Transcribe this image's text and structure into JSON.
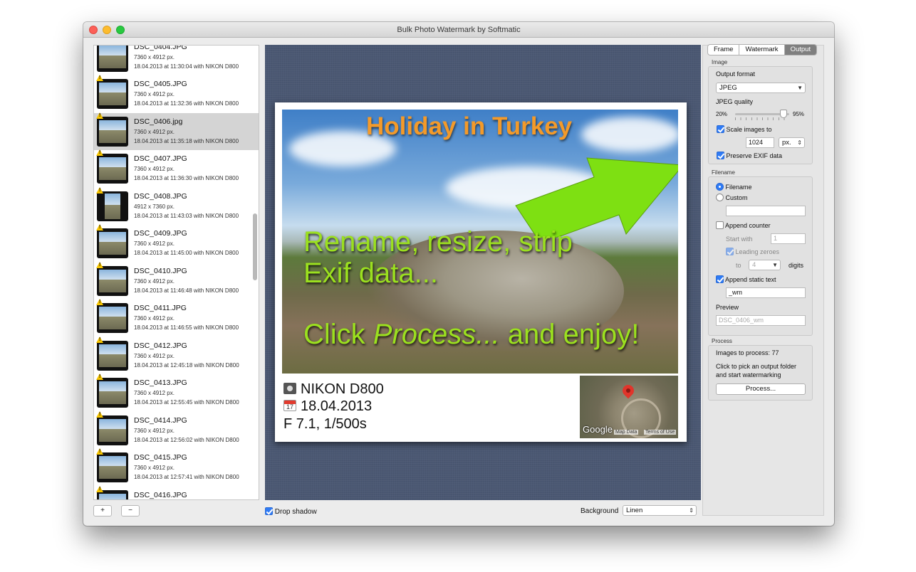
{
  "window": {
    "title": "Bulk Photo Watermark by Softmatic"
  },
  "files": [
    {
      "name": "DSC_0404.JPG",
      "dims": "7360 x 4912 px.",
      "date": "18.04.2013 at 11:30:04 with NIKON D800",
      "warn": false
    },
    {
      "name": "DSC_0405.JPG",
      "dims": "7360 x 4912 px.",
      "date": "18.04.2013 at 11:32:36 with NIKON D800",
      "warn": true
    },
    {
      "name": "DSC_0406.jpg",
      "dims": "7360 x 4912 px.",
      "date": "18.04.2013 at 11:35:18 with NIKON D800",
      "warn": true,
      "selected": true
    },
    {
      "name": "DSC_0407.JPG",
      "dims": "7360 x 4912 px.",
      "date": "18.04.2013 at 11:36:30 with NIKON D800",
      "warn": true
    },
    {
      "name": "DSC_0408.JPG",
      "dims": "4912 x 7360 px.",
      "date": "18.04.2013 at 11:43:03 with NIKON D800",
      "warn": true,
      "portrait": true
    },
    {
      "name": "DSC_0409.JPG",
      "dims": "7360 x 4912 px.",
      "date": "18.04.2013 at 11:45:00 with NIKON D800",
      "warn": true
    },
    {
      "name": "DSC_0410.JPG",
      "dims": "7360 x 4912 px.",
      "date": "18.04.2013 at 11:46:48 with NIKON D800",
      "warn": true
    },
    {
      "name": "DSC_0411.JPG",
      "dims": "7360 x 4912 px.",
      "date": "18.04.2013 at 11:46:55 with NIKON D800",
      "warn": true
    },
    {
      "name": "DSC_0412.JPG",
      "dims": "7360 x 4912 px.",
      "date": "18.04.2013 at 12:45:18 with NIKON D800",
      "warn": true
    },
    {
      "name": "DSC_0413.JPG",
      "dims": "7360 x 4912 px.",
      "date": "18.04.2013 at 12:55:45 with NIKON D800",
      "warn": true
    },
    {
      "name": "DSC_0414.JPG",
      "dims": "7360 x 4912 px.",
      "date": "18.04.2013 at 12:56:02 with NIKON D800",
      "warn": true
    },
    {
      "name": "DSC_0415.JPG",
      "dims": "7360 x 4912 px.",
      "date": "18.04.2013 at 12:57:41 with NIKON D800",
      "warn": true
    },
    {
      "name": "DSC_0416.JPG",
      "dims": "",
      "date": "",
      "warn": true
    }
  ],
  "list_buttons": {
    "add": "+",
    "remove": "−"
  },
  "preview": {
    "title": "Holiday in Turkey",
    "line1": "Rename, resize, strip",
    "line2": "Exif data...",
    "line3_pre": "Click ",
    "line3_em": "Process...",
    "line3_post": " and enjoy!",
    "camera": "NIKON D800",
    "date": "18.04.2013",
    "calendar_day": "17",
    "exposure": "F 7.1, 1/500s",
    "map_logo": "Google",
    "map_data": "Map Data",
    "map_terms": "Terms of Use"
  },
  "bottom": {
    "drop_shadow": "Drop shadow",
    "background_label": "Background",
    "background_value": "Linen"
  },
  "tabs": [
    "Frame",
    "Watermark",
    "Output"
  ],
  "image": {
    "section": "Image",
    "output_format_label": "Output format",
    "output_format": "JPEG",
    "quality_label": "JPEG quality",
    "quality_min": "20%",
    "quality_max": "95%",
    "quality_value_fraction": 0.9,
    "scale_label": "Scale images to",
    "scale_value": "1024",
    "scale_unit": "px.",
    "exif_label": "Preserve EXIF data"
  },
  "filename": {
    "section": "Filename",
    "opt_filename": "Filename",
    "opt_custom": "Custom",
    "custom_value": "",
    "append_counter": "Append counter",
    "start_with": "Start with",
    "start_value": "1",
    "leading_zeroes": "Leading zeroes",
    "to": "to",
    "digits_value": "4",
    "digits": "digits",
    "append_static": "Append static text",
    "static_value": "_wm",
    "preview_label": "Preview",
    "preview_value": "DSC_0406_wm"
  },
  "process": {
    "section": "Process",
    "count_text": "Images to process: 77",
    "hint": "Click to pick an output folder and start watermarking",
    "button": "Process..."
  },
  "colors": {
    "accent": "#2f7bf5",
    "canvas": "#4b5873",
    "overlay_green": "#9be01f",
    "overlay_orange": "#f39a2a"
  }
}
